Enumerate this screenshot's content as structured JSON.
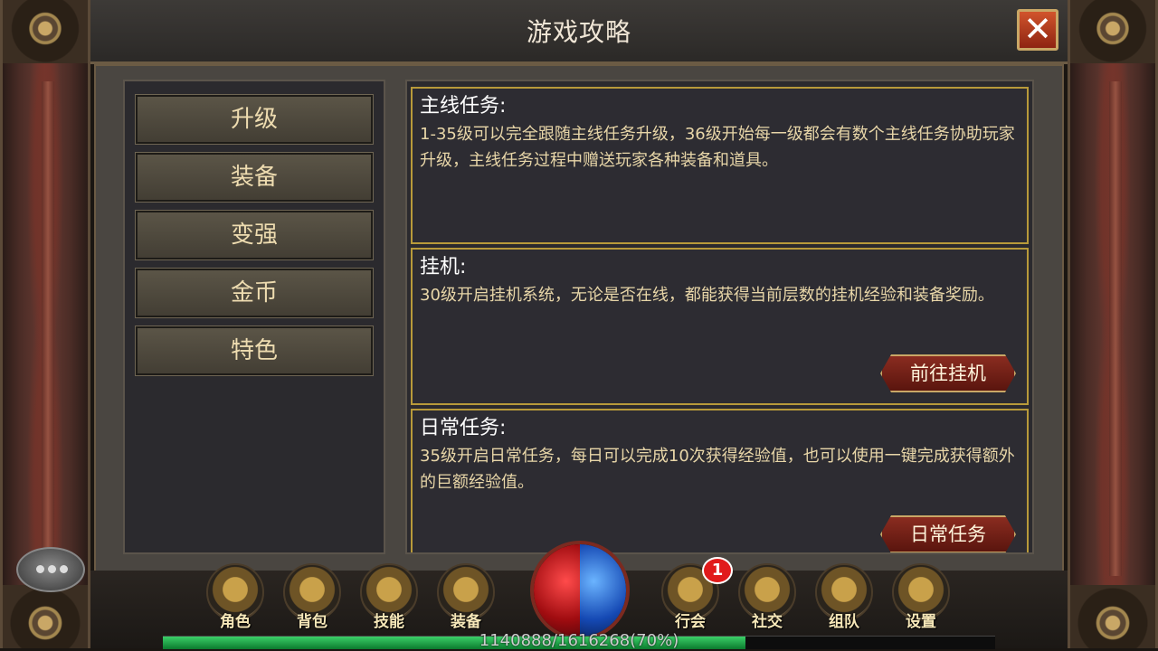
{
  "window": {
    "title": "游戏攻略",
    "close_label": "✕"
  },
  "menu": {
    "items": [
      {
        "label": "升级"
      },
      {
        "label": "装备"
      },
      {
        "label": "变强"
      },
      {
        "label": "金币"
      },
      {
        "label": "特色"
      }
    ]
  },
  "sections": [
    {
      "title": "主线任务:",
      "text": "1-35级可以完全跟随主线任务升级，36级开始每一级都会有数个主线任务协助玩家升级，主线任务过程中赠送玩家各种装备和道具。"
    },
    {
      "title": "挂机:",
      "text": "30级开启挂机系统，无论是否在线，都能获得当前层数的挂机经验和装备奖励。",
      "button": "前往挂机"
    },
    {
      "title": "日常任务:",
      "text": "35级开启日常任务，每日可以完成10次获得经验值，也可以使用一键完成获得额外的巨额经验值。",
      "button": "日常任务"
    }
  ],
  "hud": {
    "buttons": [
      {
        "label": "角色",
        "icon": "horse-head-icon"
      },
      {
        "label": "背包",
        "icon": "bag-icon"
      },
      {
        "label": "技能",
        "icon": "book-icon"
      },
      {
        "label": "装备",
        "icon": "hammer-icon"
      },
      {
        "label": "行会",
        "icon": "banner-icon"
      },
      {
        "label": "社交",
        "icon": "handshake-icon"
      },
      {
        "label": "组队",
        "icon": "team-icon"
      },
      {
        "label": "设置",
        "icon": "gear-icon"
      }
    ],
    "guild_badge": "1",
    "xp_text": "1140888/1616268(70%)",
    "xp_fraction": 0.7
  },
  "colors": {
    "accent_gold": "#c9a766",
    "hp": "#d81a1a",
    "mp": "#1a5ad8",
    "xp": "#2ebf5a"
  }
}
